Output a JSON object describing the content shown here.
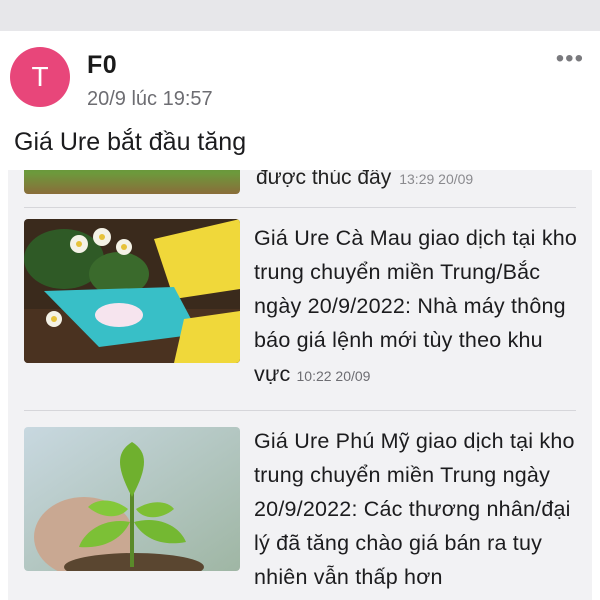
{
  "post": {
    "avatar_letter": "T",
    "author": "F0",
    "timestamp": "20/9 lúc 19:57",
    "caption": "Giá Ure bắt đầu tăng",
    "more_icon": "more-horizontal-icon"
  },
  "shared": {
    "previous_fragment": {
      "text": "được thúc đẩy",
      "meta": "13:29 20/09"
    },
    "articles": [
      {
        "title": "Giá Ure Cà Mau giao dịch tại kho trung chuyển miền Trung/Bắc ngày 20/9/2022: Nhà máy thông báo giá lệnh mới tùy theo khu vực",
        "time": "10:22 20/09"
      },
      {
        "title": "Giá Ure Phú Mỹ giao dịch tại kho trung chuyển miền Trung ngày 20/9/2022: Các thương nhân/đại lý đã tăng chào giá bán ra tuy nhiên vẫn thấp hơn",
        "time": ""
      }
    ]
  },
  "colors": {
    "avatar": "#e8467a",
    "background": "#ffffff",
    "card": "#f2f2f4",
    "secondary_text": "#6d6d72"
  }
}
